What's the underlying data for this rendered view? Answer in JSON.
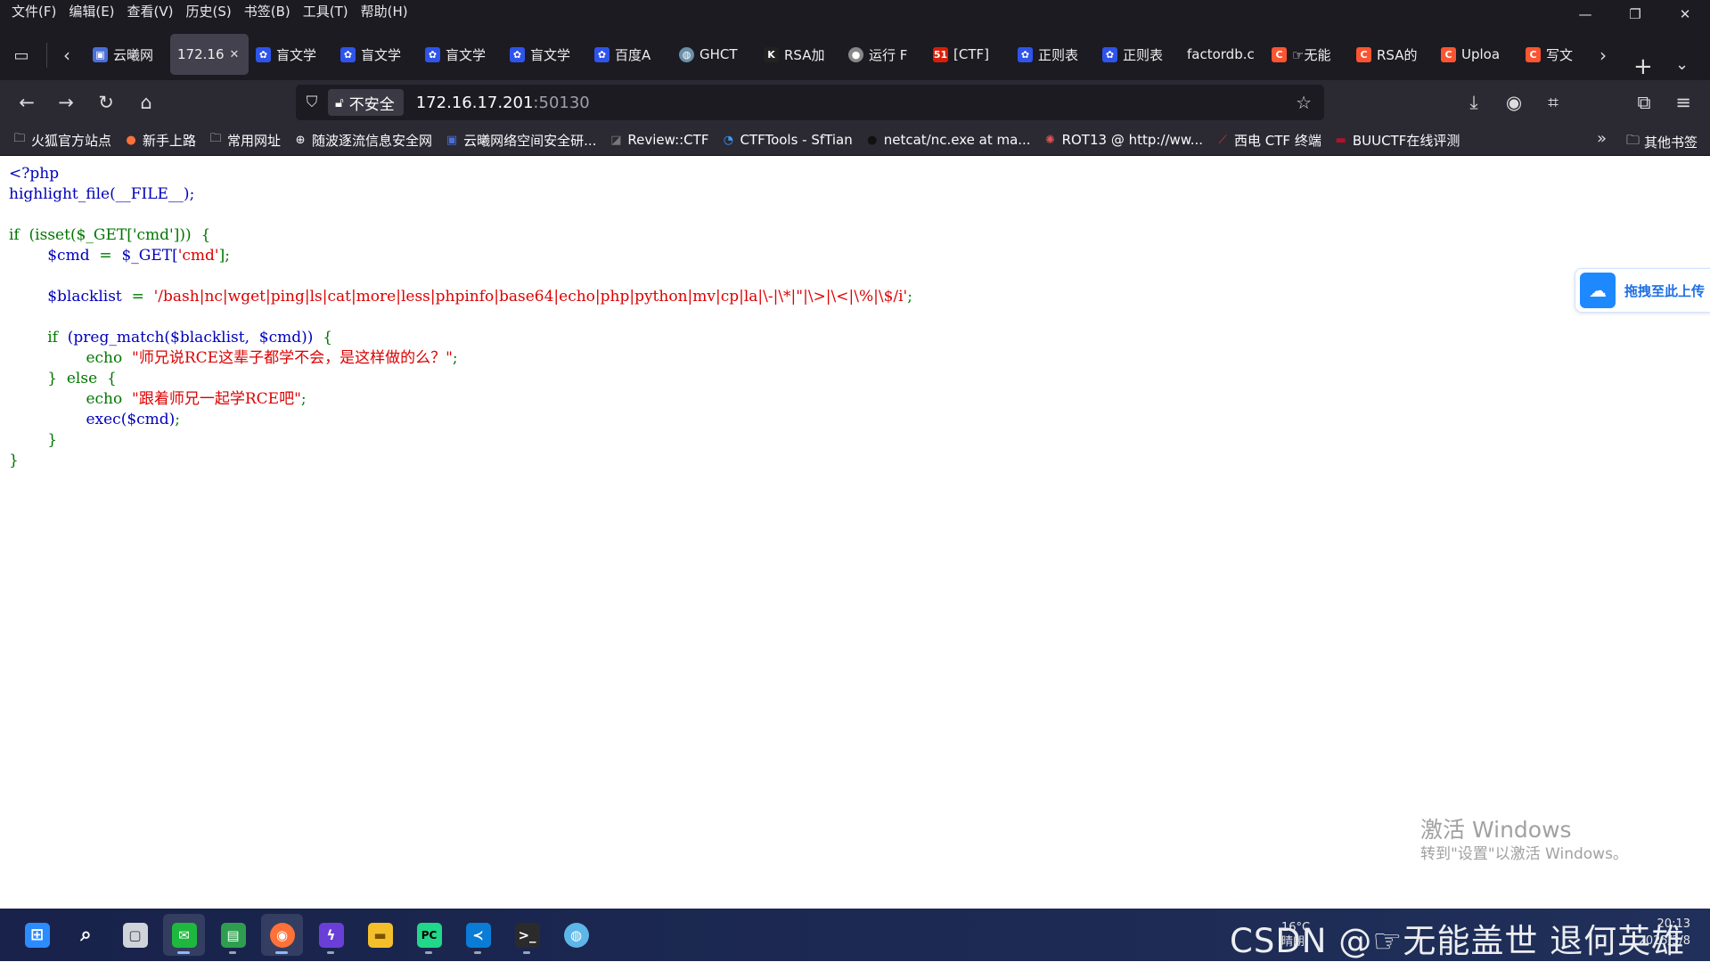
{
  "menubar": {
    "items": [
      "文件(F)",
      "编辑(E)",
      "查看(V)",
      "历史(S)",
      "书签(B)",
      "工具(T)",
      "帮助(H)"
    ]
  },
  "tabs": [
    {
      "label": "云曦网",
      "icon": "site-icon",
      "color": "#4a6fd8"
    },
    {
      "label": "172.16",
      "active": true
    },
    {
      "label": "盲文学",
      "icon": "baidu-paw-icon",
      "color": "#2f54eb"
    },
    {
      "label": "盲文学",
      "icon": "baidu-paw-icon",
      "color": "#2f54eb"
    },
    {
      "label": "盲文学",
      "icon": "baidu-paw-icon",
      "color": "#2f54eb"
    },
    {
      "label": "盲文学",
      "icon": "baidu-paw-icon",
      "color": "#2f54eb"
    },
    {
      "label": "百度A",
      "icon": "baidu-paw-icon",
      "color": "#2f54eb"
    },
    {
      "label": "GHCT",
      "icon": "globe-icon",
      "color": "#6b8fa8"
    },
    {
      "label": "RSA加",
      "icon": "k-letter-icon",
      "color": "#222222"
    },
    {
      "label": "运行 F",
      "icon": "avatar-icon",
      "color": "#888888"
    },
    {
      "label": "[CTF]",
      "icon": "51cto-icon",
      "color": "#d81e06"
    },
    {
      "label": "正则表",
      "icon": "baidu-paw-icon",
      "color": "#2f54eb"
    },
    {
      "label": "正则表",
      "icon": "baidu-paw-icon",
      "color": "#2f54eb"
    },
    {
      "label": "factordb.c",
      "icon": "",
      "color": ""
    },
    {
      "label": "☞无能",
      "icon": "csdn-icon",
      "color": "#fc5531"
    },
    {
      "label": "RSA的",
      "icon": "csdn-icon",
      "color": "#fc5531"
    },
    {
      "label": "Uploa",
      "icon": "csdn-icon",
      "color": "#fc5531"
    },
    {
      "label": "写文",
      "icon": "csdn-icon",
      "color": "#fc5531"
    }
  ],
  "navbar": {
    "security_label": "不安全",
    "url_host": "172.16.17.201",
    "url_port": ":50130"
  },
  "bookmarks": [
    {
      "label": "火狐官方站点",
      "icon": "folder-icon"
    },
    {
      "label": "新手上路",
      "icon": "firefox-icon"
    },
    {
      "label": "常用网址",
      "icon": "folder-icon"
    },
    {
      "label": "随波逐流信息安全网",
      "icon": "globe-icon"
    },
    {
      "label": "云曦网络空间安全研...",
      "icon": "site-icon"
    },
    {
      "label": "Review::CTF",
      "icon": "page-icon"
    },
    {
      "label": "CTFTools - SfTian",
      "icon": "ctftools-icon"
    },
    {
      "label": "netcat/nc.exe at ma...",
      "icon": "github-icon"
    },
    {
      "label": "ROT13 @ http://ww...",
      "icon": "rot13-icon"
    },
    {
      "label": "西电 CTF 终端",
      "icon": "xidian-icon"
    },
    {
      "label": "BUUCTF在线评测",
      "icon": "buuctf-icon"
    }
  ],
  "bookmarks_other": "其他书签",
  "code": {
    "l1": "<?php",
    "l2": "highlight_file(__FILE__);",
    "if1": "if",
    "l4_cond": "  (isset($_GET['cmd']))",
    "brace": "  {",
    "l5_var": "        $cmd",
    "l5_eq": "  =  ",
    "l5_get": "$_GET[",
    "l5_str": "'cmd'",
    "l5_end": "];",
    "l7_var": "        $blacklist",
    "l7_eq": "  =  ",
    "l7_str": "'/bash|nc|wget|ping|ls|cat|more|less|phpinfo|base64|echo|php|python|mv|cp|la|\\-|\\*|\"|\\>|\\<|\\%|\\$/i'",
    "semi": ";",
    "l9_ind": "        ",
    "l9_if": "if",
    "l9_cond": "  (preg_match($blacklist,  $cmd))",
    "l9_brace": "  {",
    "l10_ind": "                ",
    "echo": "echo",
    "l10_str": "  \"师兄说RCE这辈子都学不会，是这样做的么？\"",
    "l11_close": "        }",
    "l11_else": "  else",
    "l11_brace": "  {",
    "l12_str": "  \"跟着师兄一起学RCE吧\"",
    "l13_exec": "                exec($cmd)",
    "l14": "        }",
    "l15": "}"
  },
  "upload_widget": {
    "label": "拖拽至此上传"
  },
  "activate_windows": {
    "line1": "激活 Windows",
    "line2": "转到\"设置\"以激活 Windows。"
  },
  "taskbar": {
    "watermark": "CSDN @☞无能盖世 退何英雄",
    "weather_temp": "16°C",
    "weather_desc": "晴朗",
    "time": "20:13",
    "date": "2025/3/8"
  }
}
